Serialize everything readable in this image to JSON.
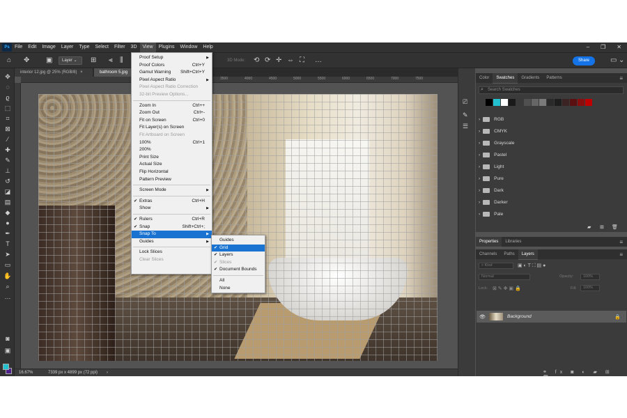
{
  "menubar": {
    "items": [
      "File",
      "Edit",
      "Image",
      "Layer",
      "Type",
      "Select",
      "Filter",
      "3D",
      "View",
      "Plugins",
      "Window",
      "Help"
    ],
    "active": "View",
    "logo": "Ps"
  },
  "options_bar": {
    "layer_select": "Layer",
    "mode_3d": "3D Mode:",
    "share": "Share"
  },
  "tabs": {
    "doc1": "interior 12.jpg @ 25% (RGB/8)",
    "doc1_close": "×",
    "doc2": "bathroom 5.jpg"
  },
  "ruler": {
    "labels": [
      "3500",
      "4000",
      "4500",
      "5000",
      "5500",
      "6000",
      "6500",
      "7000",
      "7500"
    ]
  },
  "status": {
    "zoom": "16.67%",
    "dimensions": "7339 px x 4899 px (72 ppi)"
  },
  "view_menu": {
    "items": [
      {
        "label": "Proof Setup",
        "shortcut": "",
        "arrow": true,
        "disabled": false
      },
      {
        "label": "Proof Colors",
        "shortcut": "Ctrl+Y",
        "arrow": false,
        "disabled": false
      },
      {
        "label": "Gamut Warning",
        "shortcut": "Shift+Ctrl+Y",
        "arrow": false,
        "disabled": false
      },
      {
        "label": "Pixel Aspect Ratio",
        "shortcut": "",
        "arrow": true,
        "disabled": false
      },
      {
        "label": "Pixel Aspect Ratio Correction",
        "shortcut": "",
        "arrow": false,
        "disabled": true
      },
      {
        "label": "32-bit Preview Options...",
        "shortcut": "",
        "arrow": false,
        "disabled": true
      },
      {
        "label": "Zoom In",
        "shortcut": "Ctrl++",
        "arrow": false,
        "disabled": false
      },
      {
        "label": "Zoom Out",
        "shortcut": "Ctrl+-",
        "arrow": false,
        "disabled": false
      },
      {
        "label": "Fit on Screen",
        "shortcut": "Ctrl+0",
        "arrow": false,
        "disabled": false
      },
      {
        "label": "Fit Layer(s) on Screen",
        "shortcut": "",
        "arrow": false,
        "disabled": false
      },
      {
        "label": "Fit Artboard on Screen",
        "shortcut": "",
        "arrow": false,
        "disabled": true
      },
      {
        "label": "100%",
        "shortcut": "Ctrl+1",
        "arrow": false,
        "disabled": false
      },
      {
        "label": "200%",
        "shortcut": "",
        "arrow": false,
        "disabled": false
      },
      {
        "label": "Print Size",
        "shortcut": "",
        "arrow": false,
        "disabled": false
      },
      {
        "label": "Actual Size",
        "shortcut": "",
        "arrow": false,
        "disabled": false
      },
      {
        "label": "Flip Horizontal",
        "shortcut": "",
        "arrow": false,
        "disabled": false
      },
      {
        "label": "Pattern Preview",
        "shortcut": "",
        "arrow": false,
        "disabled": false
      },
      {
        "label": "Screen Mode",
        "shortcut": "",
        "arrow": true,
        "disabled": false
      },
      {
        "label": "Extras",
        "shortcut": "Ctrl+H",
        "arrow": false,
        "disabled": false,
        "checked": true
      },
      {
        "label": "Show",
        "shortcut": "",
        "arrow": true,
        "disabled": false
      },
      {
        "label": "Rulers",
        "shortcut": "Ctrl+R",
        "arrow": false,
        "disabled": false,
        "checked": true
      },
      {
        "label": "Snap",
        "shortcut": "Shift+Ctrl+;",
        "arrow": false,
        "disabled": false,
        "checked": true
      },
      {
        "label": "Snap To",
        "shortcut": "",
        "arrow": true,
        "disabled": false,
        "highlighted": true
      },
      {
        "label": "Guides",
        "shortcut": "",
        "arrow": true,
        "disabled": false
      },
      {
        "label": "Lock Slices",
        "shortcut": "",
        "arrow": false,
        "disabled": false
      },
      {
        "label": "Clear Slices",
        "shortcut": "",
        "arrow": false,
        "disabled": true
      }
    ]
  },
  "snap_submenu": {
    "items": [
      {
        "label": "Guides",
        "checked": false,
        "disabled": false
      },
      {
        "label": "Grid",
        "checked": true,
        "disabled": false,
        "highlighted": true
      },
      {
        "label": "Layers",
        "checked": true,
        "disabled": false
      },
      {
        "label": "Slices",
        "checked": true,
        "disabled": true
      },
      {
        "label": "Document Bounds",
        "checked": true,
        "disabled": false
      },
      {
        "label": "All",
        "checked": false,
        "disabled": false
      },
      {
        "label": "None",
        "checked": false,
        "disabled": false
      }
    ]
  },
  "swatches_panel": {
    "tabs": [
      "Color",
      "Swatches",
      "Gradients",
      "Patterns"
    ],
    "active_tab": "Swatches",
    "search_placeholder": "Search Swatches",
    "recent_colors": [
      "#000000",
      "#23c1cf",
      "#ffffff",
      "#1a1a1a",
      "#3a3a3a",
      "#505050",
      "#666666",
      "#7a7a7a",
      "#2a2a2a",
      "#1e1e1e",
      "#3b2323",
      "#5a1010",
      "#8a0e0e",
      "#c00000"
    ],
    "folders": [
      "RGB",
      "CMYK",
      "Grayscale",
      "Pastel",
      "Light",
      "Pure",
      "Dark",
      "Darker",
      "Pale"
    ]
  },
  "properties_panel": {
    "tabs": [
      "Properties",
      "Libraries"
    ],
    "active_tab": "Properties"
  },
  "layers_panel": {
    "tabs": [
      "Channels",
      "Paths",
      "Layers"
    ],
    "active_tab": "Layers",
    "filter": "Kind",
    "blend_mode": "Normal",
    "opacity_label": "Opacity:",
    "opacity_value": "100%",
    "lock_label": "Lock:",
    "fill_label": "Fill:",
    "fill_value": "100%",
    "layers": [
      {
        "name": "Background",
        "locked": true,
        "visible": true
      }
    ]
  },
  "colors": {
    "foreground": "#23c1cf",
    "background": "#4c1f8a",
    "menu_highlight": "#1a73d0",
    "share": "#1473e6"
  }
}
